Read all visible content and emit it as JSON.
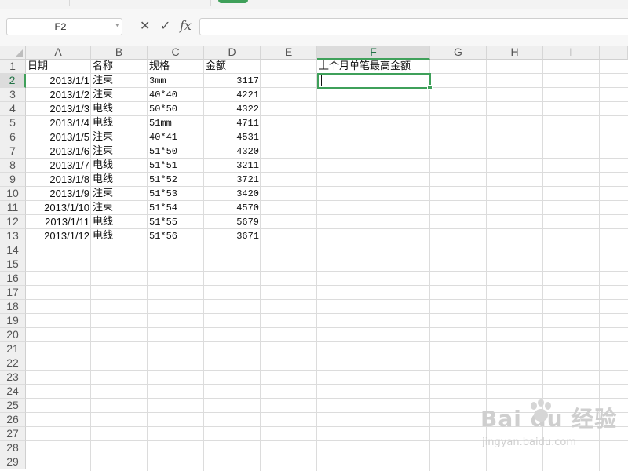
{
  "formula_bar": {
    "name_box": "F2",
    "cancel_icon": "✕",
    "confirm_icon": "✓",
    "fx_label": "fx",
    "formula_value": ""
  },
  "columns": [
    "A",
    "B",
    "C",
    "D",
    "E",
    "F",
    "G",
    "H",
    "I"
  ],
  "active_column": "F",
  "rows": [
    "1",
    "2",
    "3",
    "4",
    "5",
    "6",
    "7",
    "8",
    "9",
    "10",
    "11",
    "12",
    "13",
    "14",
    "15",
    "16",
    "17",
    "18",
    "19",
    "20",
    "21",
    "22",
    "23",
    "24",
    "25",
    "26",
    "27",
    "28",
    "29"
  ],
  "active_row": "2",
  "headers": {
    "a": "日期",
    "b": "名称",
    "c": "规格",
    "d": "金额",
    "f": "上个月单笔最高金额"
  },
  "data_rows": [
    {
      "a": "2013/1/1",
      "b": "注束",
      "c": "3mm",
      "d": "3117"
    },
    {
      "a": "2013/1/2",
      "b": "注束",
      "c": "40*40",
      "d": "4221"
    },
    {
      "a": "2013/1/3",
      "b": "电线",
      "c": "50*50",
      "d": "4322"
    },
    {
      "a": "2013/1/4",
      "b": "电线",
      "c": "51mm",
      "d": "4711"
    },
    {
      "a": "2013/1/5",
      "b": "注束",
      "c": "40*41",
      "d": "4531"
    },
    {
      "a": "2013/1/6",
      "b": "注束",
      "c": "51*50",
      "d": "4320"
    },
    {
      "a": "2013/1/7",
      "b": "电线",
      "c": "51*51",
      "d": "3211"
    },
    {
      "a": "2013/1/8",
      "b": "电线",
      "c": "51*52",
      "d": "3721"
    },
    {
      "a": "2013/1/9",
      "b": "注束",
      "c": "51*53",
      "d": "3420"
    },
    {
      "a": "2013/1/10",
      "b": "注束",
      "c": "51*54",
      "d": "4570"
    },
    {
      "a": "2013/1/11",
      "b": "电线",
      "c": "51*55",
      "d": "5679"
    },
    {
      "a": "2013/1/12",
      "b": "电线",
      "c": "51*56",
      "d": "3671"
    }
  ],
  "watermark": {
    "main": "Bai du 经验",
    "sub": "jingyan.baidu.com"
  },
  "colors": {
    "accent": "#3fa05a",
    "grid": "#dcdcdc",
    "header_bg": "#efefef"
  }
}
